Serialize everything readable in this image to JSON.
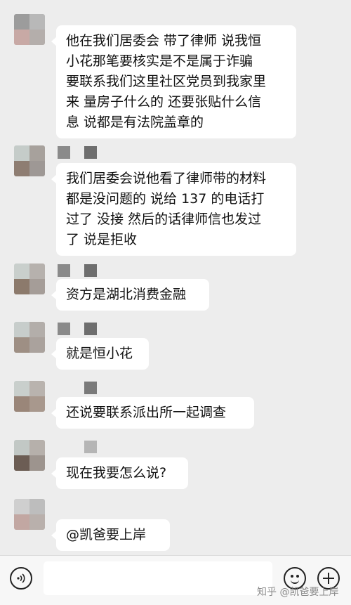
{
  "messages": [
    {
      "lines": [
        "他在我们居委会 带了律师 说我恒",
        "小花那笔要核实是不是属于诈骗",
        "要联系我们这里社区党员到我家里",
        "来 量房子什么的 还要张贴什么信",
        "息 说都是有法院盖章的"
      ]
    },
    {
      "lines": [
        "我们居委会说他看了律师带的材料",
        "都是没问题的 说给 137 的电话打",
        "过了 没接 然后的话律师信也发过",
        "了 说是拒收"
      ]
    },
    {
      "lines": [
        "资方是湖北消费金融"
      ]
    },
    {
      "lines": [
        "就是恒小花"
      ]
    },
    {
      "lines": [
        "还说要联系派出所一起调查"
      ]
    },
    {
      "lines": [
        "现在我要怎么说?"
      ]
    },
    {
      "lines": [
        "@凯爸要上岸"
      ]
    }
  ],
  "bottom_bar": {
    "voice_icon": "voice-icon",
    "emoji_icon": "emoji-icon",
    "plus_icon": "plus-icon"
  },
  "watermark": "知乎 @凯爸要上岸"
}
